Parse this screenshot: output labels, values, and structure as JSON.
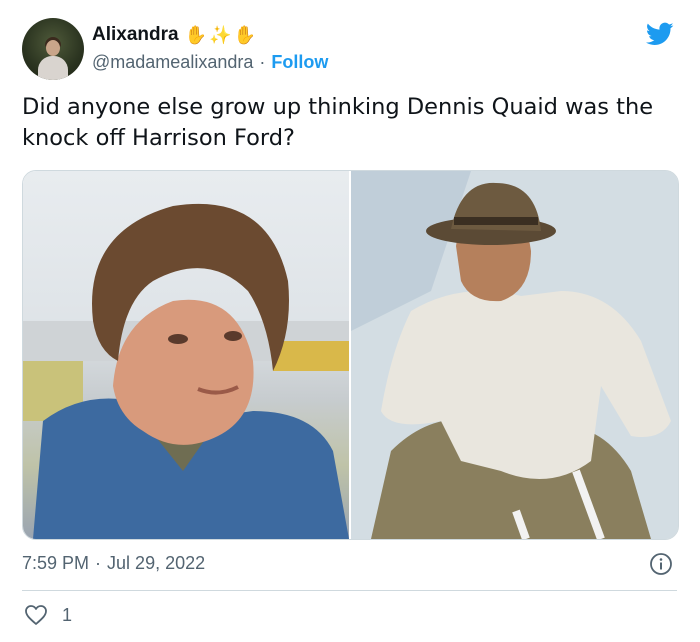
{
  "author": {
    "display_name": "Alixandra",
    "emojis": [
      "✋",
      "✨",
      "✋"
    ],
    "handle": "@madamealixandra",
    "separator": "·",
    "follow_label": "Follow"
  },
  "tweet": {
    "text": "Did anyone else grow up thinking Dennis Quaid was the knock off Harrison Ford?"
  },
  "media": {
    "images": [
      {
        "subject": "man with brown hair in a blue denim jacket"
      },
      {
        "subject": "man in a fedora hat and khaki shirt seated in a chair"
      }
    ]
  },
  "meta": {
    "time": "7:59 PM",
    "separator": "·",
    "date": "Jul 29, 2022"
  },
  "engagement": {
    "likes": "1"
  },
  "icons": {
    "brand": "twitter-bird-icon",
    "info": "info-icon",
    "like": "heart-icon"
  },
  "colors": {
    "accent": "#1d9bf0",
    "text": "#0f1419",
    "secondary": "#536471",
    "border": "#cfd9de"
  }
}
